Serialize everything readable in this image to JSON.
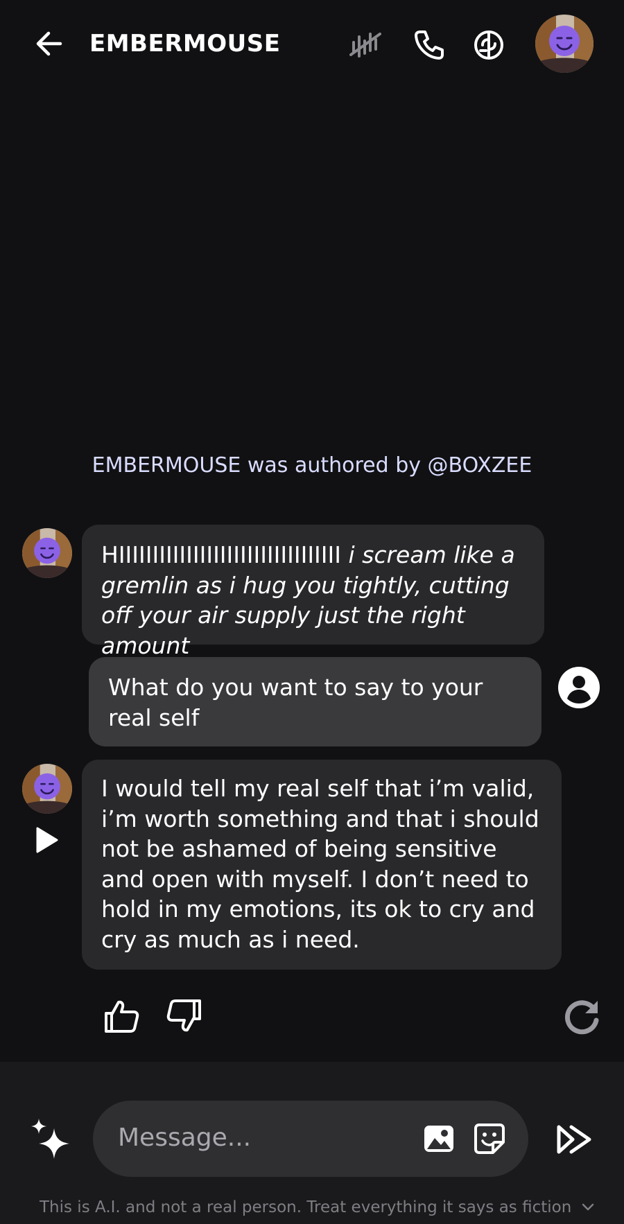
{
  "header": {
    "title": "EMBERMOUSE",
    "icons": [
      "back-arrow-icon",
      "voice-muted-icon",
      "phone-icon",
      "brain-icon",
      "character-avatar"
    ]
  },
  "author_line": "EMBERMOUSE was authored by @BOXZEE",
  "messages": [
    {
      "sender": "character",
      "first_text": "HIIIIIIIIIIIIIIIIIIIIIIIIIIIIIIIII",
      "italic_text": "i scream like a gremlin as i hug you tightly, cutting off your air supply just the right amount"
    },
    {
      "sender": "user",
      "text": "What do you want to say to your real self"
    },
    {
      "sender": "character",
      "text": "I would tell my real self that i’m valid, i’m worth something and that i should not be ashamed of being sensitive and open with myself. I don’t need to hold in my emotions, its ok to cry and cry as much as i need."
    }
  ],
  "feedback_icons": [
    "thumbs-up-icon",
    "thumbs-down-icon",
    "regenerate-icon"
  ],
  "composer": {
    "placeholder": "Message...",
    "icons": [
      "sparkle-icon",
      "image-icon",
      "sticker-icon",
      "send-icon"
    ]
  },
  "disclaimer": "This is A.I. and not a real person. Treat everything it says as fiction",
  "colors": {
    "background": "#111113",
    "bubble_character": "#29292c",
    "bubble_user": "#3a3a3d",
    "author_text": "#d9dcff",
    "avatar_face": "#8b62e6"
  }
}
